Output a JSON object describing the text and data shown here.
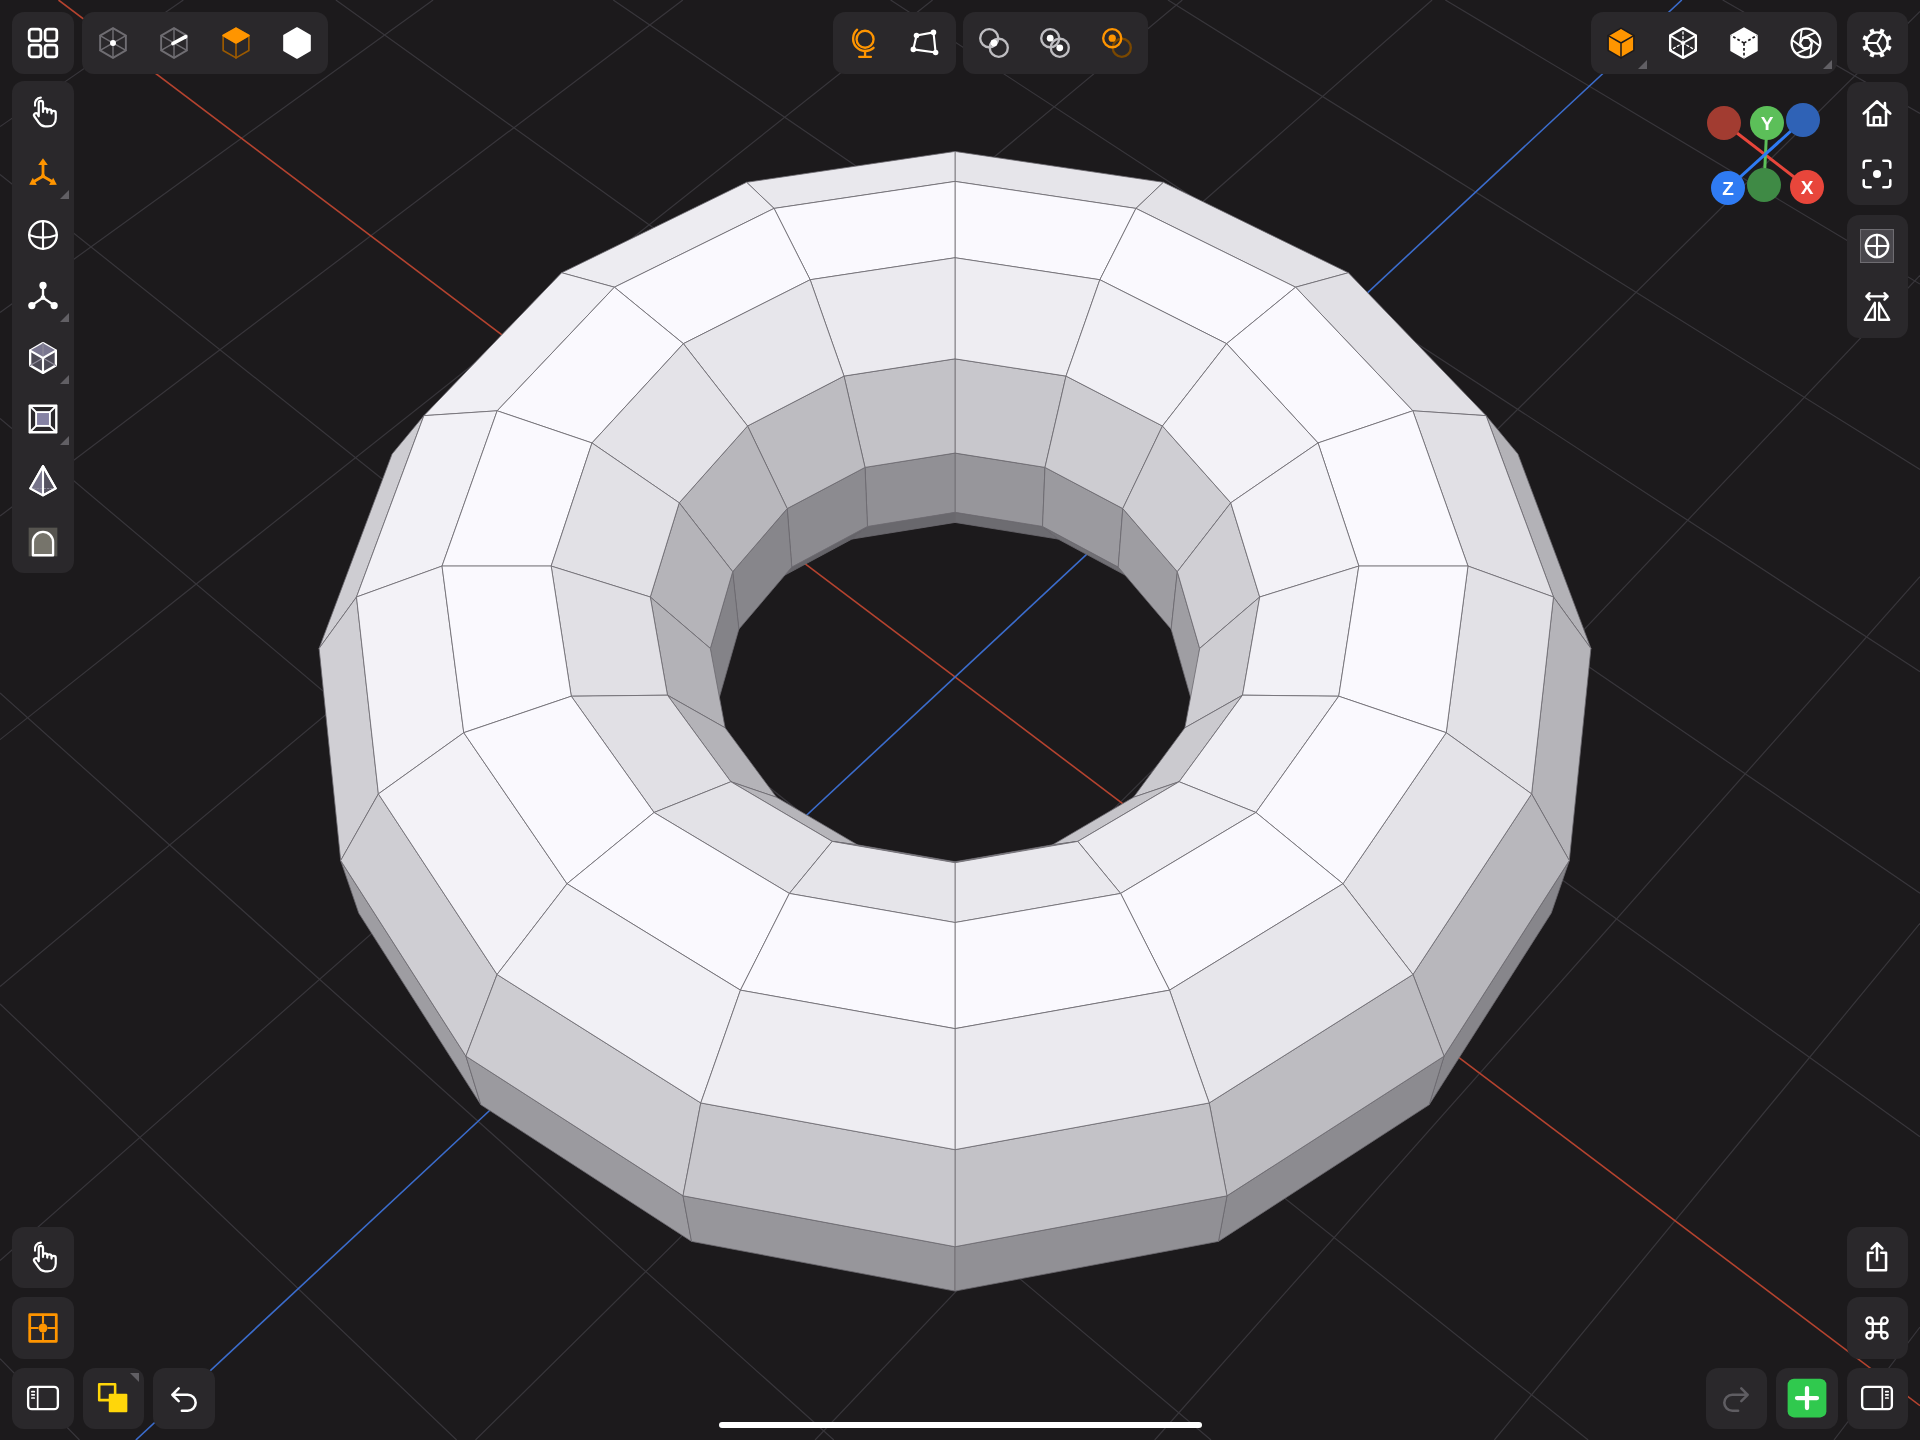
{
  "top_left_toolbar": [
    {
      "kind": "hex_dot",
      "selected": false,
      "dimmed": true
    },
    {
      "kind": "hex_line",
      "selected": false,
      "dimmed": true
    },
    {
      "kind": "cube_face",
      "selected": true,
      "dimmed": false
    },
    {
      "kind": "hex_solid",
      "selected": false,
      "dimmed": false
    }
  ],
  "center_toolbar": {
    "left_group": [
      {
        "kind": "globe",
        "selected": true
      },
      {
        "kind": "quad",
        "selected": false
      }
    ],
    "right_group": [
      {
        "kind": "rings_dot",
        "selected": false
      },
      {
        "kind": "rings_dots",
        "selected": false
      },
      {
        "kind": "rings_offset",
        "selected": true
      }
    ]
  },
  "top_right_toolbar": [
    {
      "kind": "cube_solid",
      "selected": true,
      "menu": true
    },
    {
      "kind": "cube_wire",
      "selected": false,
      "menu": false
    },
    {
      "kind": "cube_dashed",
      "selected": false,
      "menu": false
    },
    {
      "kind": "aperture",
      "selected": false,
      "menu": true
    }
  ],
  "axis_gizmo": [
    {
      "color": "#a23c31"
    },
    {
      "label": "Y",
      "color": "#5cbf59"
    },
    {
      "color": "#2f62b6"
    },
    {
      "label": "Z",
      "color": "#2f7bf3"
    },
    {
      "color": "#3f8a45"
    },
    {
      "label": "X",
      "color": "#e8463b"
    }
  ],
  "right_toolbar": {
    "upper_group": [
      {
        "kind": "house"
      },
      {
        "kind": "focus"
      }
    ],
    "lower_group": [
      {
        "kind": "crosshair",
        "selected": true
      },
      {
        "kind": "mirror",
        "selected": false
      }
    ]
  },
  "left_toolbar": [
    {
      "kind": "hand",
      "selected": false,
      "menu": false
    },
    {
      "kind": "move",
      "selected": true,
      "menu": true
    },
    {
      "kind": "sphere",
      "selected": false,
      "menu": false
    },
    {
      "kind": "nodes",
      "selected": false,
      "menu": true
    },
    {
      "kind": "cube_outline",
      "selected": false,
      "menu": true
    },
    {
      "kind": "inset",
      "selected": false,
      "menu": true
    },
    {
      "kind": "pyramid",
      "selected": false,
      "menu": false
    },
    {
      "kind": "arch",
      "selected": false,
      "menu": false
    }
  ],
  "bottom_left": {
    "stack": [
      {
        "kind": "hand",
        "selected": false
      },
      {
        "kind": "target",
        "selected": true
      }
    ],
    "row": [
      {
        "kind": "sidebar_left",
        "menu": false
      },
      {
        "kind": "squares",
        "menu": true
      },
      {
        "kind": "undo",
        "menu": false
      }
    ]
  },
  "bottom_right": {
    "stack": [
      {
        "kind": "share"
      },
      {
        "kind": "command"
      }
    ],
    "row": [
      {
        "kind": "redo",
        "disabled": true
      },
      {
        "kind": "add",
        "disabled": false
      },
      {
        "kind": "sidebar_right",
        "disabled": false
      }
    ]
  }
}
